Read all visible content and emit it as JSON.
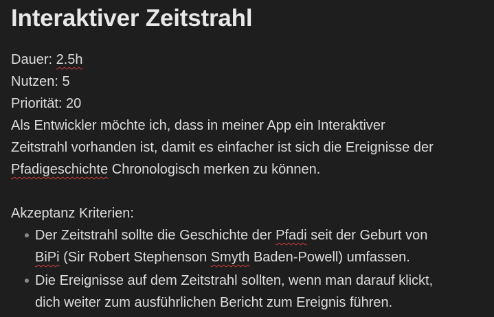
{
  "note": {
    "title": "Interaktiver Zeitstrahl",
    "meta": {
      "dauer_label": "Dauer: ",
      "dauer_value": "2.5h",
      "nutzen": "Nutzen: 5",
      "prioritaet": "Priorität: 20"
    },
    "story": {
      "line1": "Als Entwickler möchte ich, dass in meiner App ein Interaktiver",
      "line2": "Zeitstrahl vorhanden ist, damit es einfacher ist sich die Ereignisse der",
      "line3_a": "Pfadigeschichte",
      "line3_b": " Chronologisch merken zu können."
    },
    "criteria_heading": "Akzeptanz Kriterien:",
    "criteria": [
      {
        "a": "Der Zeitstrahl sollte die Geschichte der ",
        "b": "Pfadi",
        "c": " seit der Geburt von",
        "d": "BiPi",
        "e": " (Sir Robert Stephenson ",
        "f": "Smyth",
        "g": " Baden-Powell) umfassen."
      },
      {
        "a": "Die Ereignisse auf dem Zeitstrahl sollten, wenn man darauf klickt,",
        "b": "dich weiter zum ausführlichen Bericht zum Ereignis führen."
      }
    ]
  }
}
